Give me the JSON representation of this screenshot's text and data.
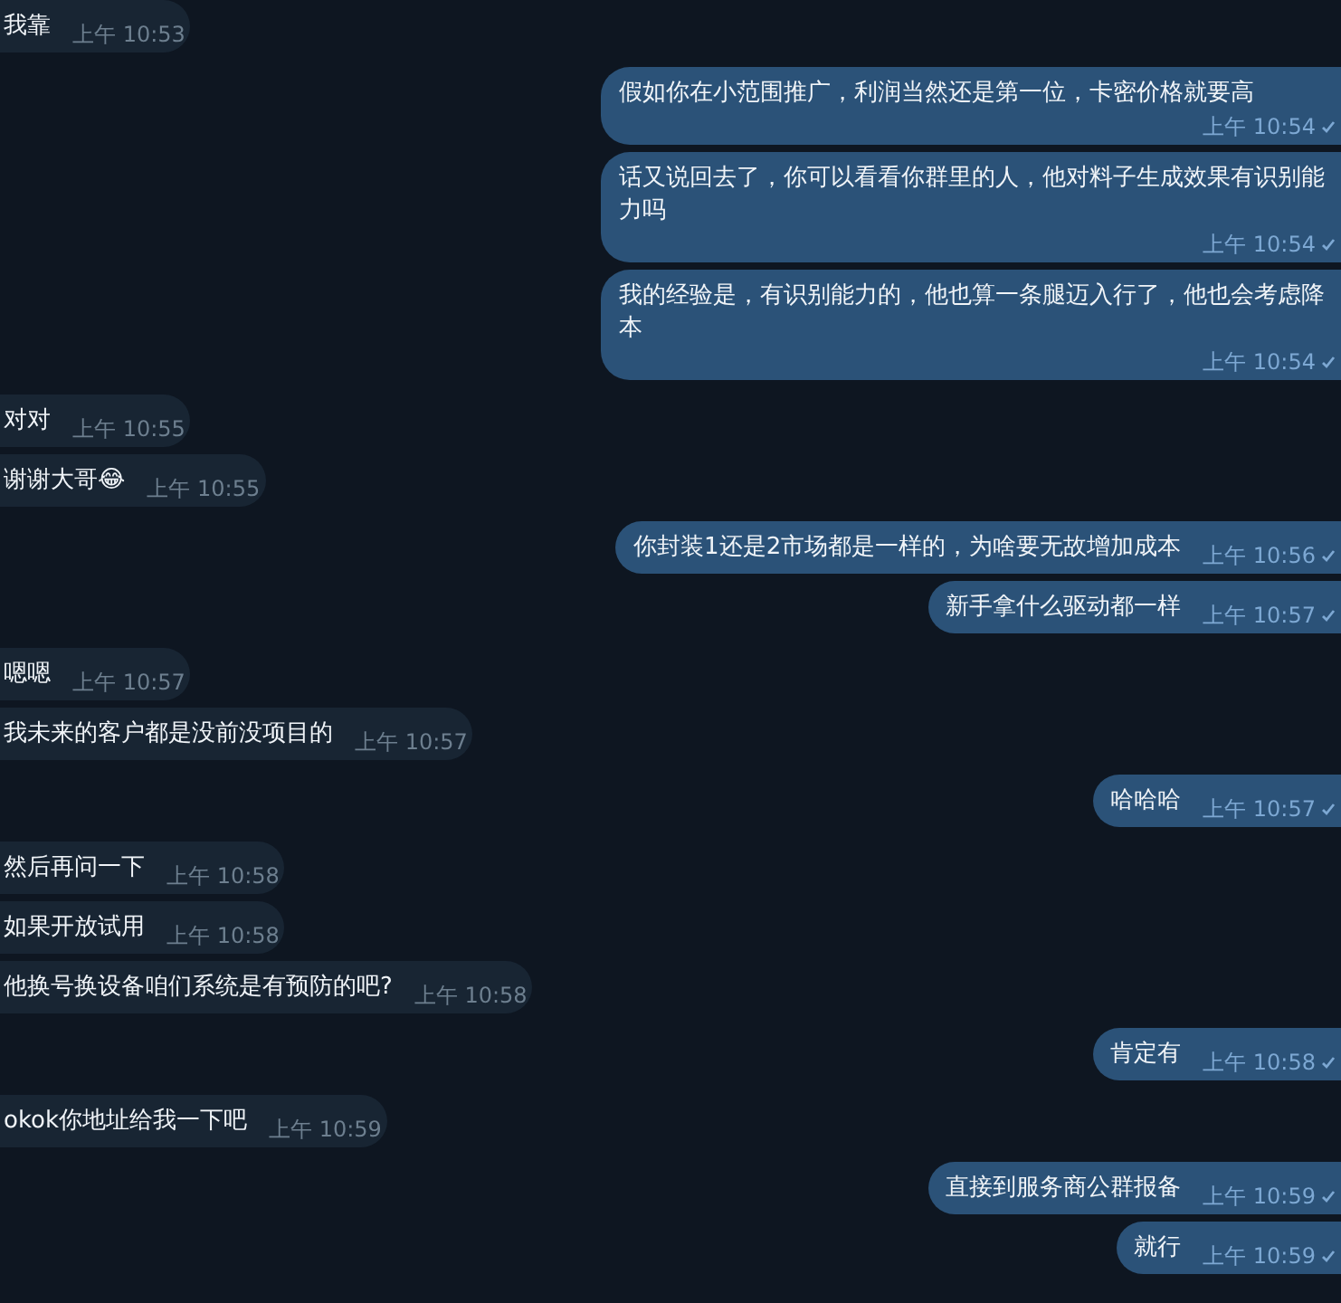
{
  "messages": [
    {
      "kind": "incoming",
      "text": "我靠",
      "time": "上午 10:53"
    },
    {
      "kind": "outgoing",
      "text": "假如你在小范围推广，利润当然还是第一位，卡密价格就要高",
      "time": "上午 10:54"
    },
    {
      "kind": "outgoing",
      "text": "话又说回去了，你可以看看你群里的人，他对料子生成效果有识别能力吗",
      "time": "上午 10:54"
    },
    {
      "kind": "outgoing",
      "text": "我的经验是，有识别能力的，他也算一条腿迈入行了，他也会考虑降本",
      "time": "上午 10:54"
    },
    {
      "kind": "incoming",
      "text": "对对",
      "time": "上午 10:55"
    },
    {
      "kind": "incoming",
      "text": "谢谢大哥😂",
      "time": "上午 10:55"
    },
    {
      "kind": "outgoing",
      "text": "你封装1还是2市场都是一样的，为啥要无故增加成本",
      "time": "上午 10:56"
    },
    {
      "kind": "outgoing",
      "text": "新手拿什么驱动都一样",
      "time": "上午 10:57"
    },
    {
      "kind": "incoming",
      "text": "嗯嗯",
      "time": "上午 10:57"
    },
    {
      "kind": "incoming",
      "text": "我未来的客户都是没前没项目的",
      "time": "上午 10:57"
    },
    {
      "kind": "outgoing",
      "text": "哈哈哈",
      "time": "上午 10:57"
    },
    {
      "kind": "incoming",
      "text": "然后再问一下",
      "time": "上午 10:58"
    },
    {
      "kind": "incoming",
      "text": "如果开放试用",
      "time": "上午 10:58"
    },
    {
      "kind": "incoming",
      "text": "他换号换设备咱们系统是有预防的吧?",
      "time": "上午 10:58"
    },
    {
      "kind": "outgoing",
      "text": "肯定有",
      "time": "上午 10:58"
    },
    {
      "kind": "incoming",
      "text": "okok你地址给我一下吧",
      "time": "上午 10:59"
    },
    {
      "kind": "outgoing",
      "text": "直接到服务商公群报备",
      "time": "上午 10:59"
    },
    {
      "kind": "outgoing",
      "text": "就行",
      "time": "上午 10:59"
    }
  ]
}
